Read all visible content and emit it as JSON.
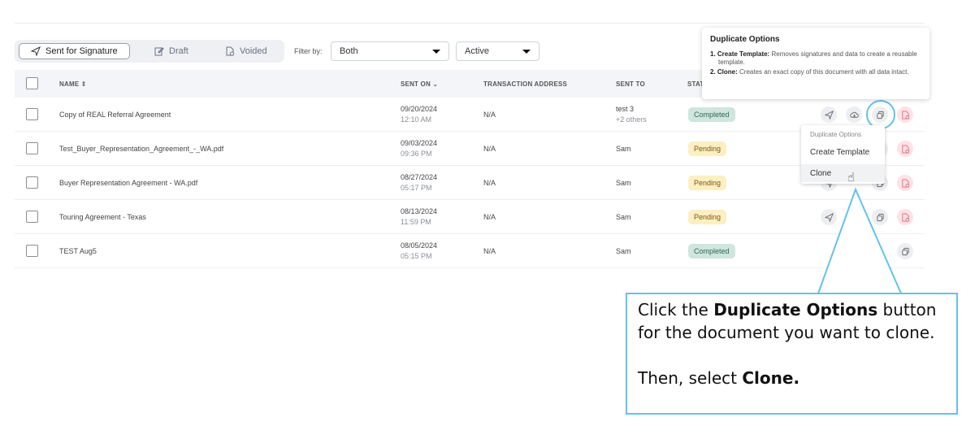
{
  "tabs": [
    {
      "label": "Sent for Signature",
      "icon": "send-icon",
      "active": true
    },
    {
      "label": "Draft",
      "icon": "edit-icon",
      "active": false
    },
    {
      "label": "Voided",
      "icon": "document-void-icon",
      "active": false
    }
  ],
  "filter": {
    "label": "Filter by:",
    "role_value": "Both",
    "status_value": "Active"
  },
  "table": {
    "headers": {
      "name": "NAME ⇕",
      "sent_on": "SENT ON ⌄",
      "transaction_address": "TRANSACTION ADDRESS",
      "sent_to": "SENT TO",
      "status": "STAT"
    },
    "rows": [
      {
        "name": "Copy of REAL Referral Agreement",
        "date": "09/20/2024",
        "time": "12:10 AM",
        "address": "N/A",
        "sent_to": "test 3",
        "sent_to_extra": "+2 others",
        "status": "Completed"
      },
      {
        "name": "Test_Buyer_Representation_Agreement_-_WA.pdf",
        "date": "09/03/2024",
        "time": "09:36 PM",
        "address": "N/A",
        "sent_to": "Sam",
        "sent_to_extra": "",
        "status": "Pending"
      },
      {
        "name": "Buyer Representation Agreement - WA.pdf",
        "date": "08/27/2024",
        "time": "05:17 PM",
        "address": "N/A",
        "sent_to": "Sam",
        "sent_to_extra": "",
        "status": "Pending"
      },
      {
        "name": "Touring Agreement - Texas",
        "date": "08/13/2024",
        "time": "11:59 PM",
        "address": "N/A",
        "sent_to": "Sam",
        "sent_to_extra": "",
        "status": "Pending"
      },
      {
        "name": "TEST Aug5",
        "date": "08/05/2024",
        "time": "05:15 PM",
        "address": "N/A",
        "sent_to": "Sam",
        "sent_to_extra": "",
        "status": "Completed"
      }
    ]
  },
  "tooltip": {
    "title": "Duplicate Options",
    "item1_num": "1.",
    "item1_label": "Create Template:",
    "item1_text": "Removes signatures and data to create a reusable template.",
    "item2_num": "2.",
    "item2_label": "Clone:",
    "item2_text": "Creates an exact copy of this document with all data intact."
  },
  "menu": {
    "heading": "Duplicate Options",
    "create_template": "Create Template",
    "clone": "Clone"
  },
  "callout": {
    "l1_pre": "Click the ",
    "l1_bold": "Duplicate Options",
    "l1_post": " button for the document you want to clone.",
    "l2_pre": "Then, select ",
    "l2_bold": "Clone."
  },
  "colors": {
    "callout_border": "#64c2ec",
    "completed_bg": "#cfe5dd",
    "pending_bg": "#fcefc2"
  }
}
